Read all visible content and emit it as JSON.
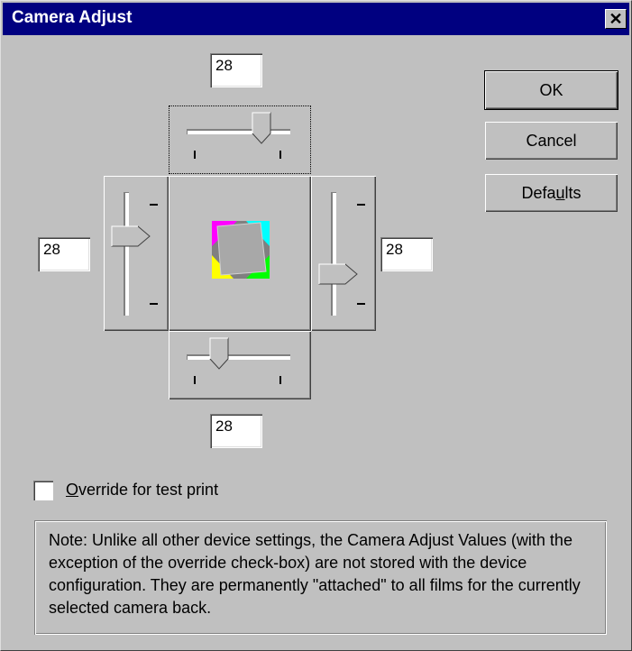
{
  "window": {
    "title": "Camera Adjust"
  },
  "values": {
    "top": "28",
    "left": "28",
    "right": "28",
    "bottom": "28"
  },
  "buttons": {
    "ok": "OK",
    "cancel": "Cancel",
    "defaults_pre": "Defa",
    "defaults_mnemonic": "u",
    "defaults_post": "lts"
  },
  "checkbox": {
    "mnemonic": "O",
    "label_rest": "verride for test print",
    "checked": false
  },
  "note": "Note: Unlike all other device settings, the Camera Adjust Values (with the exception of the override check-box) are not stored with the device configuration.  They are permanently \"attached\" to all films for the currently selected camera back.",
  "icons": {
    "close": "close-icon",
    "preview": "color-square-preview-icon"
  }
}
